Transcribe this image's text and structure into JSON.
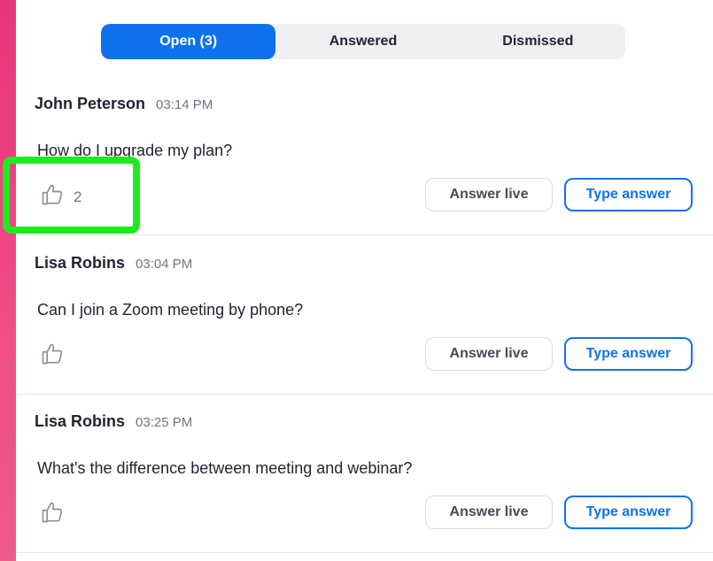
{
  "tabs": [
    {
      "label": "Open (3)",
      "active": true
    },
    {
      "label": "Answered",
      "active": false
    },
    {
      "label": "Dismissed",
      "active": false
    }
  ],
  "questions": [
    {
      "author": "John Peterson",
      "time": "03:14 PM",
      "text": "How do I upgrade my plan?",
      "upvotes": "2",
      "answer_live": "Answer live",
      "type_answer": "Type answer"
    },
    {
      "author": "Lisa Robins",
      "time": "03:04 PM",
      "text": "Can I join a Zoom meeting by phone?",
      "upvotes": "",
      "answer_live": "Answer live",
      "type_answer": "Type answer"
    },
    {
      "author": "Lisa Robins",
      "time": "03:25 PM",
      "text": "What's the difference between meeting and webinar?",
      "upvotes": "",
      "answer_live": "Answer live",
      "type_answer": "Type answer"
    }
  ],
  "colors": {
    "accent": "#0e72ed",
    "highlight": "#1fea1f",
    "background": "#e8357a"
  }
}
